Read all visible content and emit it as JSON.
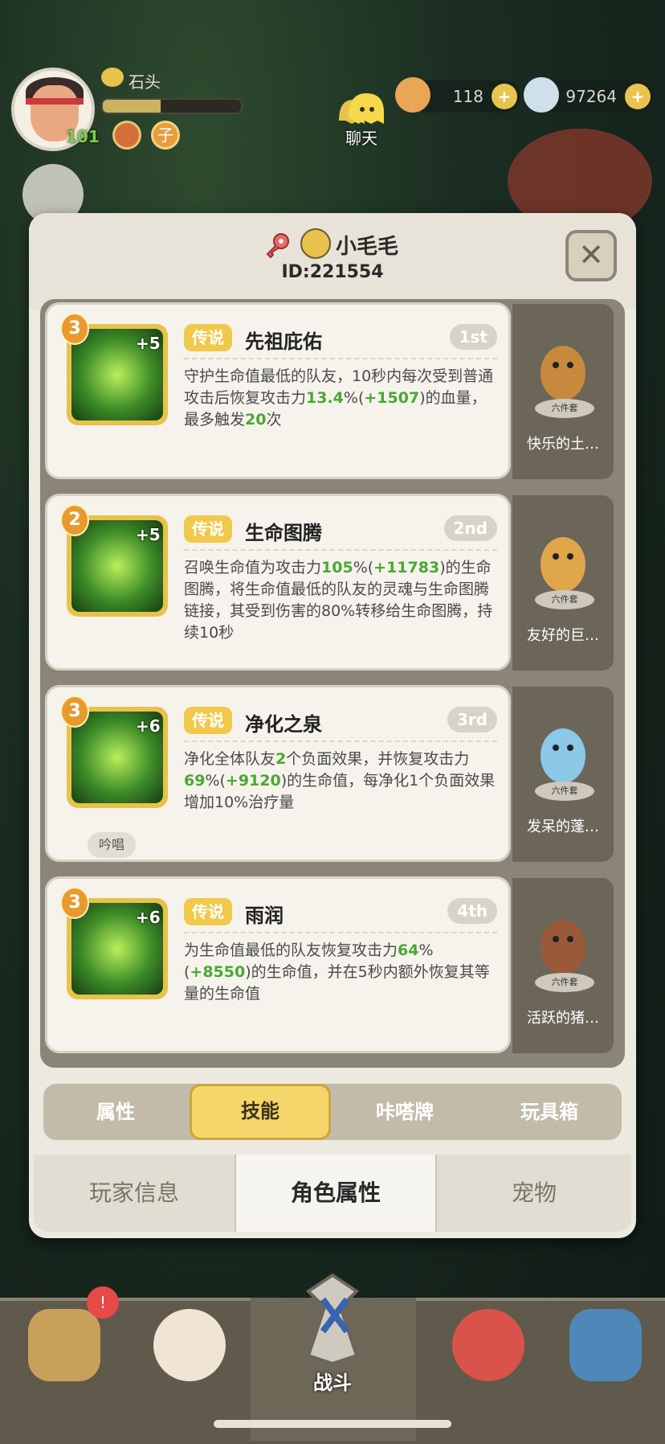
{
  "hud": {
    "player_name": "石头",
    "player_level": "101",
    "xp_progress": 0.42,
    "chat_label": "聊天",
    "resource1": {
      "value": "118",
      "icon": "pet-food-icon"
    },
    "resource2": {
      "value": "97264",
      "icon": "shell-icon"
    },
    "badge2_glyph": "子"
  },
  "modal": {
    "character_name": "小毛毛",
    "character_id": "ID:221554",
    "close_glyph": "✕"
  },
  "skills": [
    {
      "stars": "3",
      "plus": "+5",
      "tier": "传说",
      "name": "先祖庇佑",
      "rank": "1st",
      "desc": [
        {
          "t": "守护生命值最低的队友，10秒内每次受到普通攻击后恢复攻击力"
        },
        {
          "t": "13.4",
          "g": true
        },
        {
          "t": "%("
        },
        {
          "t": "+1507",
          "g": true
        },
        {
          "t": ")的血量，最多触发"
        },
        {
          "t": "20",
          "g": true
        },
        {
          "t": "次"
        }
      ],
      "pet_name": "快乐的土…",
      "pet_base": "六件套"
    },
    {
      "stars": "2",
      "plus": "+5",
      "tier": "传说",
      "name": "生命图腾",
      "rank": "2nd",
      "desc": [
        {
          "t": "召唤生命值为攻击力"
        },
        {
          "t": "105",
          "g": true
        },
        {
          "t": "%("
        },
        {
          "t": "+11783",
          "g": true
        },
        {
          "t": ")的生命图腾，将生命值最低的队友的灵魂与生命图腾链接，其受到伤害的80%转移给生命图腾，持续10秒"
        }
      ],
      "pet_name": "友好的巨…",
      "pet_base": "六件套"
    },
    {
      "stars": "3",
      "plus": "+6",
      "tier": "传说",
      "name": "净化之泉",
      "rank": "3rd",
      "desc": [
        {
          "t": "净化全体队友"
        },
        {
          "t": "2",
          "g": true
        },
        {
          "t": "个负面效果，并恢复攻击力"
        },
        {
          "t": "69",
          "g": true
        },
        {
          "t": "%("
        },
        {
          "t": "+9120",
          "g": true
        },
        {
          "t": ")的生命值，每净化1个负面效果增加10%治疗量"
        }
      ],
      "chant": "吟唱",
      "pet_name": "发呆的蓬…",
      "pet_base": "六件套"
    },
    {
      "stars": "3",
      "plus": "+6",
      "tier": "传说",
      "name": "雨润",
      "rank": "4th",
      "desc": [
        {
          "t": "为生命值最低的队友恢复攻击力"
        },
        {
          "t": "64",
          "g": true
        },
        {
          "t": "%("
        },
        {
          "t": "+8550",
          "g": true
        },
        {
          "t": ")的生命值，并在5秒内额外恢复其等量的生命值"
        }
      ],
      "pet_name": "活跃的猪…",
      "pet_base": "六件套"
    }
  ],
  "subtabs": [
    "属性",
    "技能",
    "咔嗒牌",
    "玩具箱"
  ],
  "subtab_active": 1,
  "maintabs": [
    "玩家信息",
    "角色属性",
    "宠物"
  ],
  "maintab_active": 1,
  "bottom_nav": {
    "battle_label": "战斗",
    "bell_glyph": "!",
    "icons": [
      "bear-hero-icon",
      "ninja-hero-icon",
      "battle-sword-icon",
      "red-creature-icon",
      "spell-book-icon"
    ]
  },
  "colors": {
    "accent_yellow": "#f4d66a",
    "green_value": "#4aa832",
    "tier_badge": "#f0c94a"
  }
}
